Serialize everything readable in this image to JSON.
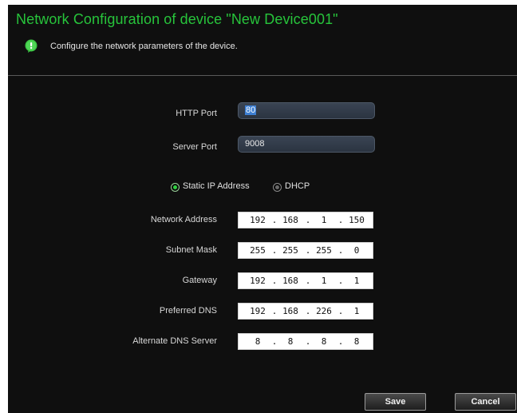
{
  "dialog": {
    "title": "Network Configuration of device \"New Device001\"",
    "subtitle": "Configure the network parameters of the device.",
    "info_icon": "info-bubble-icon",
    "accent_color": "#27c43b"
  },
  "form": {
    "http_port": {
      "label": "HTTP Port",
      "value": "80"
    },
    "server_port": {
      "label": "Server Port",
      "value": "9008"
    },
    "ip_mode": {
      "options": [
        {
          "label": "Static IP Address",
          "selected": true
        },
        {
          "label": "DHCP",
          "selected": false
        }
      ]
    },
    "network_address": {
      "label": "Network Address",
      "octets": [
        "192",
        "168",
        "1",
        "150"
      ]
    },
    "subnet_mask": {
      "label": "Subnet Mask",
      "octets": [
        "255",
        "255",
        "255",
        "0"
      ]
    },
    "gateway": {
      "label": "Gateway",
      "octets": [
        "192",
        "168",
        "1",
        "1"
      ]
    },
    "preferred_dns": {
      "label": "Preferred DNS",
      "octets": [
        "192",
        "168",
        "226",
        "1"
      ]
    },
    "alternate_dns": {
      "label": "Alternate DNS Server",
      "octets": [
        "8",
        "8",
        "8",
        "8"
      ]
    },
    "dot": "."
  },
  "footer": {
    "save_label": "Save",
    "cancel_label": "Cancel"
  }
}
